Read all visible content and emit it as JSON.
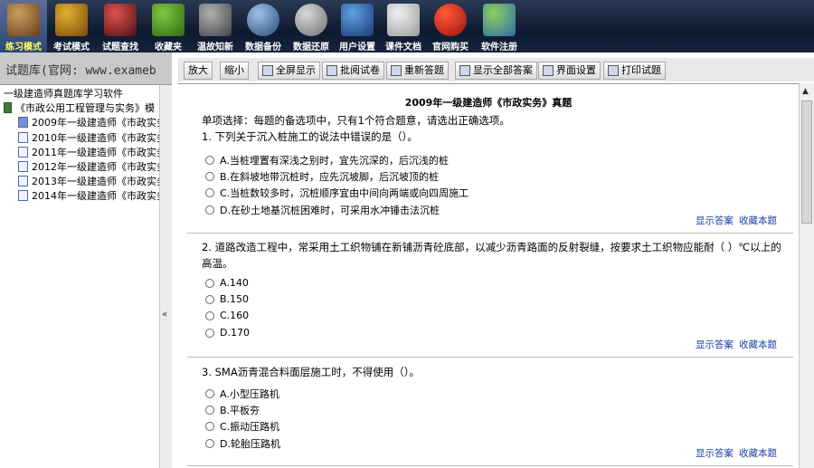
{
  "toolbar": [
    {
      "label": "练习模式",
      "icon": "books-icon"
    },
    {
      "label": "考试模式",
      "icon": "exam-folder-icon"
    },
    {
      "label": "试题查找",
      "icon": "magnifier-icon"
    },
    {
      "label": "收藏夹",
      "icon": "favorite-leaf-icon"
    },
    {
      "label": "温故知新",
      "icon": "notebook-pen-icon"
    },
    {
      "label": "数据备份",
      "icon": "disk-backup-icon"
    },
    {
      "label": "数据还原",
      "icon": "restore-arrows-icon"
    },
    {
      "label": "用户设置",
      "icon": "computer-settings-icon"
    },
    {
      "label": "课件文档",
      "icon": "document-pen-icon"
    },
    {
      "label": "官网购买",
      "icon": "internet-explorer-icon"
    },
    {
      "label": "软件注册",
      "icon": "users-icon"
    }
  ],
  "left": {
    "header": "试题库(官网: www.exameb",
    "tree": [
      {
        "label": "一级建造师真题库学习软件"
      },
      {
        "label": "《市政公用工程管理与实务》模"
      },
      {
        "label": "2009年一级建造师《市政实务"
      },
      {
        "label": "2010年一级建造师《市政实务"
      },
      {
        "label": "2011年一级建造师《市政实务"
      },
      {
        "label": "2012年一级建造师《市政实务"
      },
      {
        "label": "2013年一级建造师《市政实务"
      },
      {
        "label": "2014年一级建造师《市政实务"
      }
    ]
  },
  "buttons": {
    "zoom_in": "放大",
    "zoom_out": "缩小",
    "fullscreen": "全屏显示",
    "grade": "批阅试卷",
    "redo": "重新答题",
    "show_all": "显示全部答案",
    "ui_settings": "界面设置",
    "print": "打印试题"
  },
  "exam": {
    "title": "2009年一级建造师《市政实务》真题",
    "intro": "单项选择：每题的备选项中，只有1个符合题意，请选出正确选项。",
    "show_answer": "显示答案",
    "favorite": "收藏本题",
    "questions": [
      {
        "text": "1. 下列关于沉入桩施工的说法中错误的是（）。",
        "options": [
          "A.当桩埋置有深浅之别时，宜先沉深的，后沉浅的桩",
          "B.在斜坡地带沉桩时，应先沉坡脚，后沉坡顶的桩",
          "C.当桩数较多时，沉桩顺序宜由中间向两端或向四周施工",
          "D.在砂土地基沉桩困难时，可采用水冲锤击法沉桩"
        ]
      },
      {
        "text": "2. 道路改造工程中，常采用土工织物铺在新铺沥青砼底部，以减少沥青路面的反射裂缝，按要求土工织物应能耐（  ）℃以上的",
        "text2": "高温。",
        "options": [
          "A.140",
          "B.150",
          "C.160",
          "D.170"
        ]
      },
      {
        "text": "3. SMA沥青混合料面层施工时，不得使用（）。",
        "options": [
          "A.小型压路机",
          "B.平板夯",
          "C.振动压路机",
          "D.轮胎压路机"
        ]
      }
    ]
  }
}
